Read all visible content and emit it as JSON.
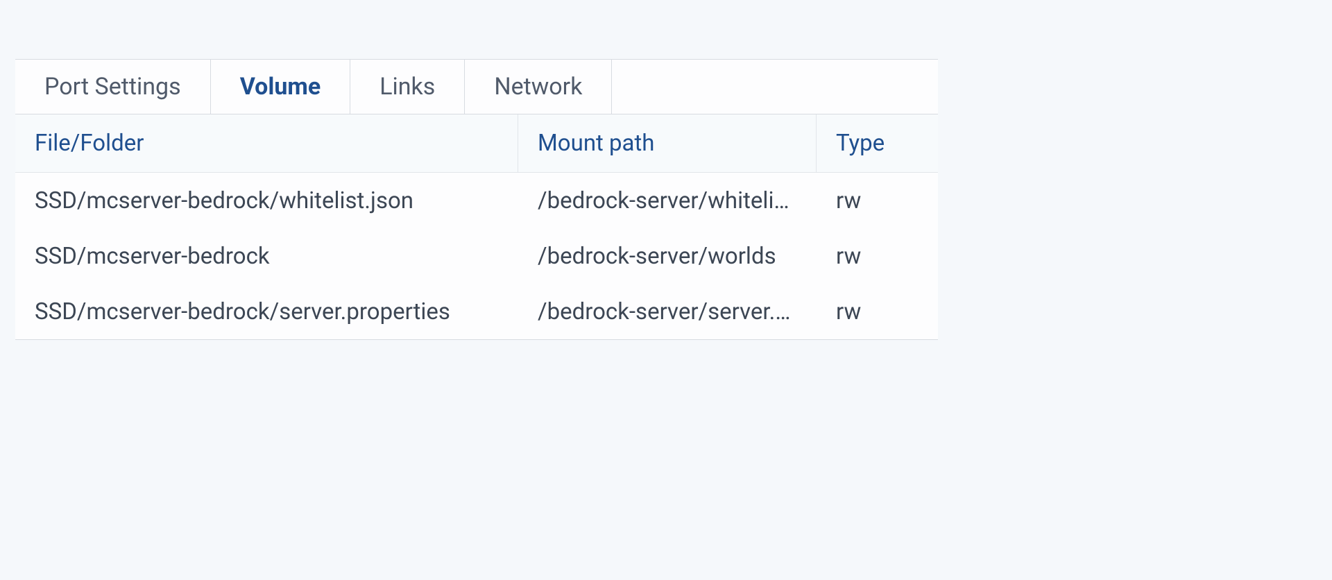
{
  "tabs": [
    {
      "label": "Port Settings",
      "active": false
    },
    {
      "label": "Volume",
      "active": true
    },
    {
      "label": "Links",
      "active": false
    },
    {
      "label": "Network",
      "active": false
    }
  ],
  "columns": {
    "file": "File/Folder",
    "mount": "Mount path",
    "type": "Type"
  },
  "rows": [
    {
      "file": "SSD/mcserver-bedrock/whitelist.json",
      "mount": "/bedrock-server/whitelist.json",
      "type": "rw"
    },
    {
      "file": "SSD/mcserver-bedrock",
      "mount": "/bedrock-server/worlds",
      "type": "rw"
    },
    {
      "file": "SSD/mcserver-bedrock/server.properties",
      "mount": "/bedrock-server/server.properties",
      "type": "rw"
    }
  ]
}
